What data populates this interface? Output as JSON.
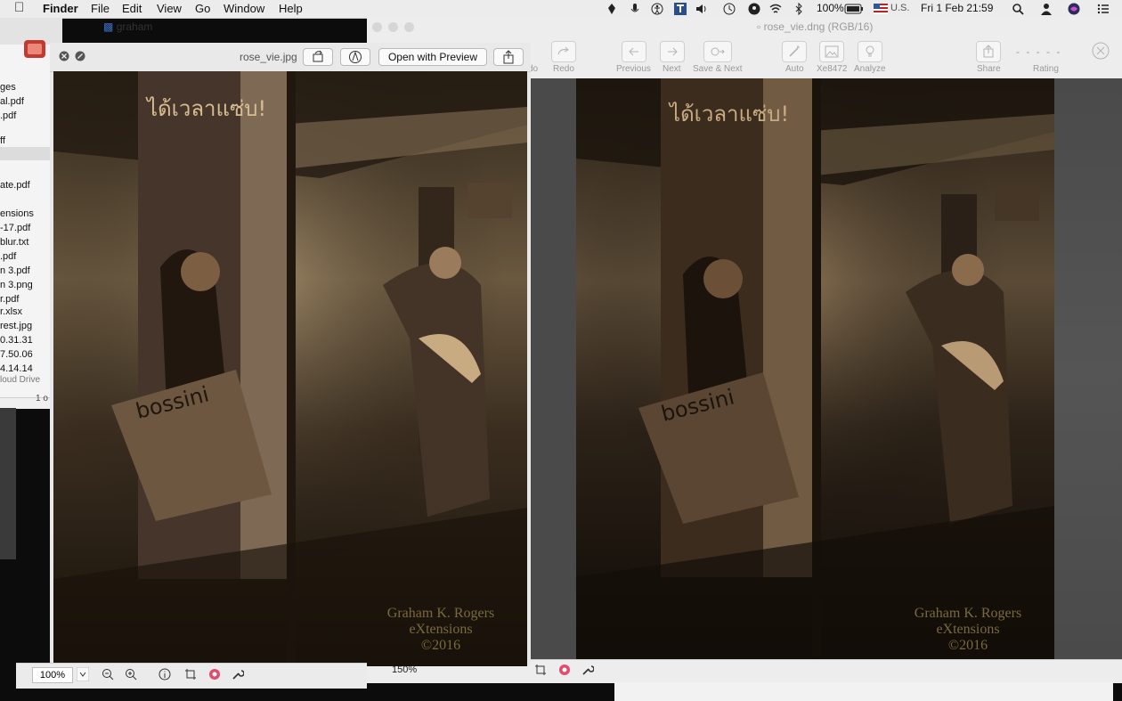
{
  "menubar": {
    "app_name": "Finder",
    "items": [
      "File",
      "Edit",
      "View",
      "Go",
      "Window",
      "Help"
    ],
    "battery": "100%",
    "input_source": "U.S.",
    "datetime": "Fri 1 Feb  21:59"
  },
  "finder": {
    "title": "graham",
    "files": [
      "ges",
      "al.pdf",
      ".pdf",
      "ff",
      "ate.pdf",
      "ensions",
      "-17.pdf",
      "blur.txt",
      ".pdf",
      "n 3.pdf",
      "n 3.png",
      "r.pdf",
      "r.xlsx",
      "rest.jpg",
      "0.31.31",
      "7.50.06",
      "4.14.14"
    ],
    "sidebar_link": "loud Drive",
    "status": "1 o"
  },
  "editor": {
    "title": "rose_vie.dng (RGB/16)",
    "toolbar": [
      {
        "label": "do"
      },
      {
        "label": "Redo"
      },
      {
        "label": "Previous"
      },
      {
        "label": "Next"
      },
      {
        "label": "Save & Next"
      },
      {
        "label": "Auto"
      },
      {
        "label": "Xe8472"
      },
      {
        "label": "Analyze"
      },
      {
        "label": "Share"
      },
      {
        "label": "Rating"
      }
    ],
    "rating_dots": "- - - - -",
    "zoom": "150%"
  },
  "quicklook": {
    "filename": "rose_vie.jpg",
    "open_with_label": "Open with Preview",
    "zoom": "100%"
  },
  "photo": {
    "watermark_line1": "Graham K. Rogers",
    "watermark_line2": "eXtensions",
    "watermark_line3": "©2016",
    "sign_text": "ได้เวลาแซ่บ!",
    "bag_text": "bossini"
  },
  "colors": {
    "menubar_bg": "#ececec",
    "window_bg": "#e9e9e9",
    "sepia_dark": "#1d150d",
    "sepia_light": "#c9ab82"
  }
}
